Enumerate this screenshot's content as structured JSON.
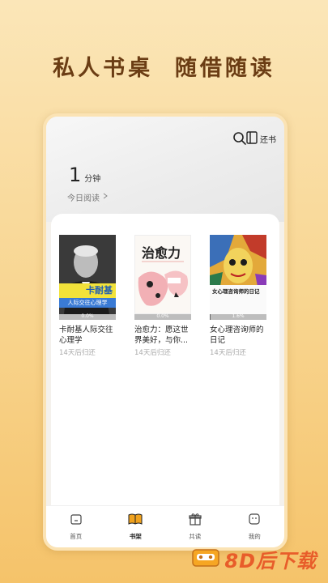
{
  "slogan": "私人书桌  随借随读",
  "header": {
    "return_label": "还书",
    "reading_time_value": "1",
    "reading_time_unit": "分钟",
    "today_label": "今日阅读"
  },
  "books": [
    {
      "title": "卡耐基人际交往心理学",
      "progress_label": "0.0%",
      "progress": 0.0,
      "due": "14天后归还"
    },
    {
      "title": "治愈力：愿这世界美好，与你...",
      "progress_label": "0.0%",
      "progress": 0.0,
      "due": "14天后归还"
    },
    {
      "title": "女心理咨询师的日记",
      "progress_label": "1.6%",
      "progress": 0.016,
      "due": "14天后归还"
    }
  ],
  "covers": {
    "book1": {
      "top": "卡耐基",
      "band": "人际交往心理学"
    },
    "book2": {
      "title": "治愈力"
    },
    "book3": {
      "title": "女心理咨询师的日记"
    }
  },
  "tabs": [
    {
      "label": "首页"
    },
    {
      "label": "书架"
    },
    {
      "label": "共读"
    },
    {
      "label": "我的"
    }
  ],
  "watermark": "8D后下载",
  "colors": {
    "accent": "#6b3d14",
    "watermark": "#e85d2a"
  }
}
